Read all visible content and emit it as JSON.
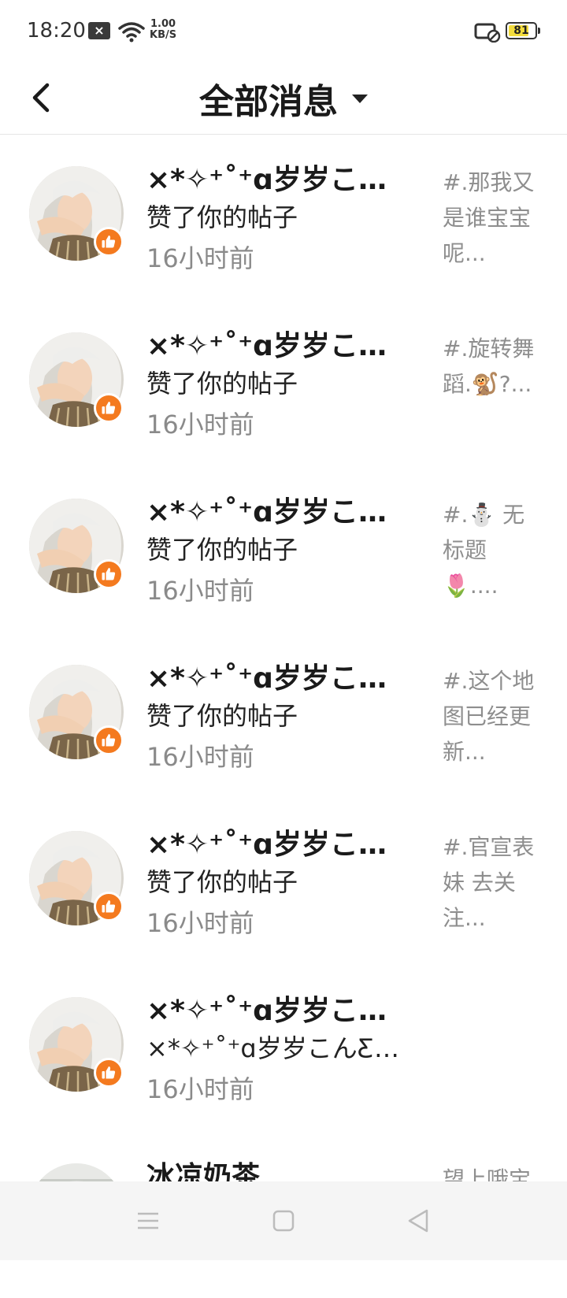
{
  "status_bar": {
    "time": "18:20",
    "notification_icon": "close-box-icon",
    "speed_value": "1.00",
    "speed_unit": "KB/S",
    "battery": "81",
    "battery_level": 0.81,
    "battery_color": "#f3dc3c"
  },
  "header": {
    "title": "全部消息",
    "back_icon": "chevron-left-icon",
    "dropdown_icon": "caret-down-icon"
  },
  "colors": {
    "accent": "#f47a1f",
    "secondary_text": "#8e8e8e"
  },
  "messages": [
    {
      "name": "×*✧⁺˚⁺ɑ岁岁こんƸ⋈",
      "action": "赞了你的帖子",
      "time": "16小时前",
      "preview": "#.那我又是谁宝宝呢...",
      "badge_icon": "thumbs-up-icon"
    },
    {
      "name": "×*✧⁺˚⁺ɑ岁岁こんƸ⋈",
      "action": "赞了你的帖子",
      "time": "16小时前",
      "preview": "#.旋转舞蹈.🐒?...",
      "badge_icon": "thumbs-up-icon"
    },
    {
      "name": "×*✧⁺˚⁺ɑ岁岁こんƸ⋈",
      "action": "赞了你的帖子",
      "time": "16小时前",
      "preview": "#.⛄ 无标题 🌷....",
      "badge_icon": "thumbs-up-icon"
    },
    {
      "name": "×*✧⁺˚⁺ɑ岁岁こんƸ⋈",
      "action": "赞了你的帖子",
      "time": "16小时前",
      "preview": "#.这个地图已经更新...",
      "badge_icon": "thumbs-up-icon"
    },
    {
      "name": "×*✧⁺˚⁺ɑ岁岁こんƸ⋈",
      "action": "赞了你的帖子",
      "time": "16小时前",
      "preview": "#.官宣表妹 去关注...",
      "badge_icon": "thumbs-up-icon"
    },
    {
      "name": "×*✧⁺˚⁺ɑ岁岁こんƸ⋈",
      "action": "×*✧⁺˚⁺ɑ岁岁こんƸ⋈...",
      "time": "16小时前",
      "preview": "",
      "badge_icon": "thumbs-up-icon"
    },
    {
      "name": "冰凉奶茶",
      "action": "",
      "time": "",
      "preview": "望上哦宝",
      "badge_icon": ""
    }
  ],
  "nav_bar": {
    "menu_icon": "menu-icon",
    "home_icon": "home-square-icon",
    "back_icon": "back-triangle-icon"
  }
}
